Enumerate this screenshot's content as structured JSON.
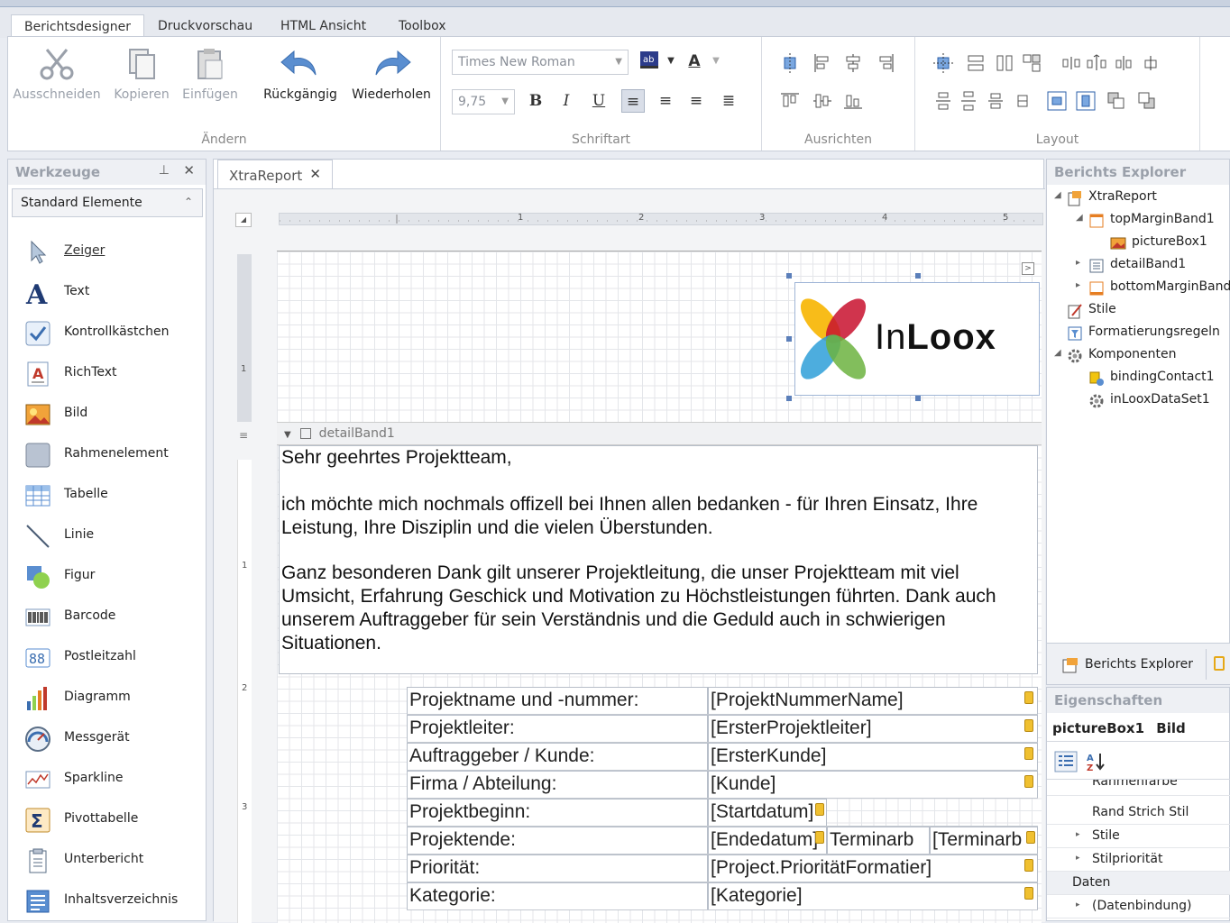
{
  "ribbon": {
    "tabs": [
      "Berichtsdesigner",
      "Druckvorschau",
      "HTML Ansicht",
      "Toolbox"
    ],
    "groups": {
      "aendern": {
        "label": "Ändern",
        "cut": "Ausschneiden",
        "copy": "Kopieren",
        "paste": "Einfügen",
        "undo": "Rückgängig",
        "redo": "Wiederholen"
      },
      "schriftart": {
        "label": "Schriftart",
        "font": "Times New Roman",
        "size": "9,75",
        "bold": "B",
        "italic": "I",
        "underline": "U"
      },
      "ausrichten": {
        "label": "Ausrichten"
      },
      "layout": {
        "label": "Layout"
      }
    }
  },
  "toolbox": {
    "title": "Werkzeuge",
    "category": "Standard Elemente",
    "items": [
      {
        "label": "Zeiger",
        "icon": "pointer-icon"
      },
      {
        "label": "Text",
        "icon": "text-icon"
      },
      {
        "label": "Kontrollkästchen",
        "icon": "checkbox-icon"
      },
      {
        "label": "RichText",
        "icon": "richtext-icon"
      },
      {
        "label": "Bild",
        "icon": "picture-icon"
      },
      {
        "label": "Rahmenelement",
        "icon": "panel-icon"
      },
      {
        "label": "Tabelle",
        "icon": "table-icon"
      },
      {
        "label": "Linie",
        "icon": "line-icon"
      },
      {
        "label": "Figur",
        "icon": "shape-icon"
      },
      {
        "label": "Barcode",
        "icon": "barcode-icon"
      },
      {
        "label": "Postleitzahl",
        "icon": "zipcode-icon"
      },
      {
        "label": "Diagramm",
        "icon": "chart-icon"
      },
      {
        "label": "Messgerät",
        "icon": "gauge-icon"
      },
      {
        "label": "Sparkline",
        "icon": "sparkline-icon"
      },
      {
        "label": "Pivottabelle",
        "icon": "pivot-icon"
      },
      {
        "label": "Unterbericht",
        "icon": "subreport-icon"
      },
      {
        "label": "Inhaltsverzeichnis",
        "icon": "toc-icon"
      }
    ]
  },
  "document": {
    "tab": "XtraReport",
    "ruler_marks": [
      "1",
      "2",
      "3",
      "4",
      "5"
    ],
    "vruler_marks": [
      "1",
      "1",
      "2",
      "3"
    ],
    "detail_band": "detailBand1",
    "logo_text_light": "In",
    "logo_text_bold": "Loox",
    "letter": [
      "Sehr geehrtes Projektteam,",
      "ich möchte mich nochmals offizell bei Ihnen allen bedanken - für Ihren Einsatz, Ihre Leistung, Ihre Disziplin und die vielen Überstunden.",
      "Ganz besonderen Dank gilt unserer Projektleitung, die unser Projektteam mit viel Umsicht, Erfahrung Geschick und Motivation zu Höchstleistungen führten. Dank auch unserem Auftraggeber für sein Verständnis und die Geduld auch in schwierigen Situationen."
    ],
    "table": [
      {
        "label": "Projektname und -nummer:",
        "value": "[ProjektNummerName]"
      },
      {
        "label": "Projektleiter:",
        "value": "[ErsterProjektleiter]"
      },
      {
        "label": "Auftraggeber / Kunde:",
        "value": "[ErsterKunde]"
      },
      {
        "label": "Firma / Abteilung:",
        "value": "[Kunde]"
      },
      {
        "label": "Projektbeginn:",
        "value": "[Startdatum]"
      },
      {
        "label": "Projektende:",
        "value": "[Endedatum]",
        "extra1": "Terminarb",
        "extra2": "[Terminarb"
      },
      {
        "label": "Priorität:",
        "value": "[Project.PrioritätFormatier]"
      },
      {
        "label": "Kategorie:",
        "value": "[Kategorie]"
      }
    ]
  },
  "explorer": {
    "title": "Berichts Explorer",
    "nodes": [
      {
        "label": "XtraReport"
      },
      {
        "label": "topMarginBand1"
      },
      {
        "label": "pictureBox1"
      },
      {
        "label": "detailBand1"
      },
      {
        "label": "bottomMarginBand"
      },
      {
        "label": "Stile"
      },
      {
        "label": "Formatierungsregeln"
      },
      {
        "label": "Komponenten"
      },
      {
        "label": "bindingContact1"
      },
      {
        "label": "inLooxDataSet1"
      }
    ],
    "footer_tab": "Berichts Explorer"
  },
  "properties": {
    "title": "Eigenschaften",
    "selected_name": "pictureBox1",
    "selected_type": "Bild",
    "rows": [
      "Rahmenfarbe",
      "Rand Strich Stil",
      "Stile",
      "Stilpriorität"
    ],
    "section": "Daten",
    "data_row": "(Datenbindung)"
  }
}
